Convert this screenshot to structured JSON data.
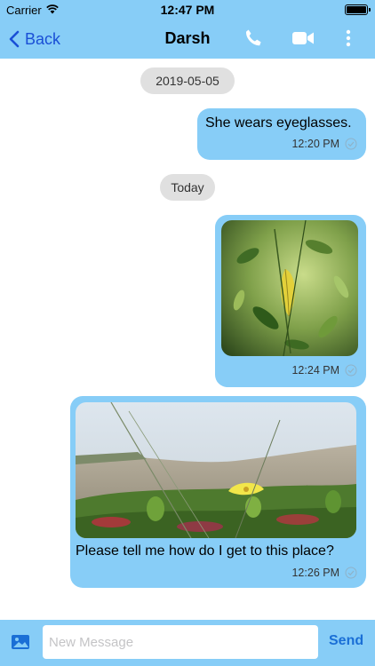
{
  "status_bar": {
    "carrier": "Carrier",
    "time": "12:47 PM"
  },
  "nav": {
    "back_label": "Back",
    "title": "Darsh",
    "accent_color": "#1a4fd6",
    "bar_color": "#87cdf7"
  },
  "messages": [
    {
      "type": "date",
      "label": "2019-05-05"
    },
    {
      "type": "text",
      "text": "She wears eyeglasses.",
      "time": "12:20 PM"
    },
    {
      "type": "date",
      "label": "Today"
    },
    {
      "type": "image",
      "image": "yellow-leaf-on-green-plant",
      "time": "12:24 PM"
    },
    {
      "type": "image",
      "image": "beach-dunes-with-yellow-flower",
      "caption": "Please tell me how do I get to this place?",
      "time": "12:26 PM"
    }
  ],
  "composer": {
    "placeholder": "New Message",
    "send_label": "Send"
  }
}
